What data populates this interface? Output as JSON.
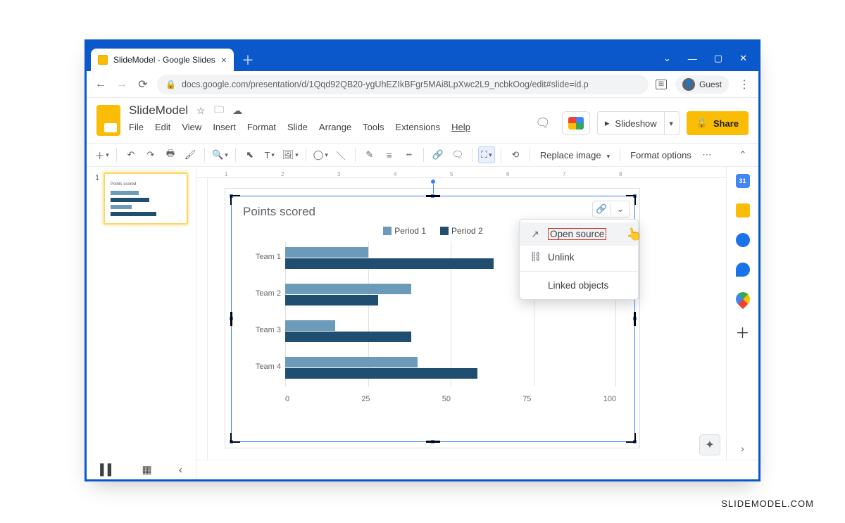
{
  "browser": {
    "tab_title": "SlideModel - Google Slides",
    "url": "docs.google.com/presentation/d/1Qqd92QB20-ygUhEZIkBFgr5MAi8LpXwc2L9_ncbkOog/edit#slide=id.p",
    "guest_label": "Guest"
  },
  "doc": {
    "title": "SlideModel",
    "menus": [
      "File",
      "Edit",
      "View",
      "Insert",
      "Format",
      "Slide",
      "Arrange",
      "Tools",
      "Extensions",
      "Help"
    ],
    "slideshow_label": "Slideshow",
    "share_label": "Share"
  },
  "toolbar": {
    "replace_image": "Replace image",
    "format_options": "Format options"
  },
  "ruler_ticks": [
    "1",
    "2",
    "3",
    "4",
    "5",
    "6",
    "7",
    "8"
  ],
  "thumb": {
    "number": "1"
  },
  "chart_data": {
    "type": "bar",
    "orientation": "horizontal",
    "title": "Points scored",
    "categories": [
      "Team 1",
      "Team 2",
      "Team 3",
      "Team 4"
    ],
    "series": [
      {
        "name": "Period 1",
        "color": "#6b9bb8",
        "values": [
          25,
          38,
          15,
          40
        ]
      },
      {
        "name": "Period 2",
        "color": "#1f4e70",
        "values": [
          63,
          28,
          38,
          58
        ]
      }
    ],
    "xlim": [
      0,
      100
    ],
    "xticks": [
      0,
      25,
      50,
      75,
      100
    ]
  },
  "link_menu": {
    "open_source": "Open source",
    "unlink": "Unlink",
    "linked_objects": "Linked objects"
  },
  "watermark": "SLIDEMODEL.COM"
}
